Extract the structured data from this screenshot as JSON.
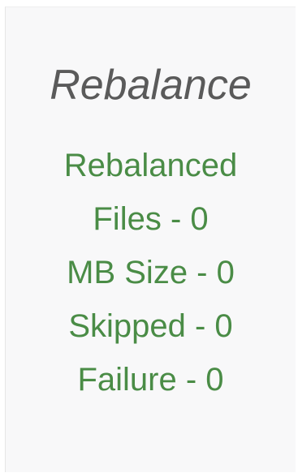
{
  "panel": {
    "title": "Rebalance",
    "lines": [
      "Rebalanced",
      "Files - 0",
      "MB Size - 0",
      "Skipped - 0",
      "Failure - 0"
    ]
  },
  "colors": {
    "title": "#5a5a5a",
    "stats": "#4a8c46",
    "panel_background": "#f8f8f9"
  }
}
